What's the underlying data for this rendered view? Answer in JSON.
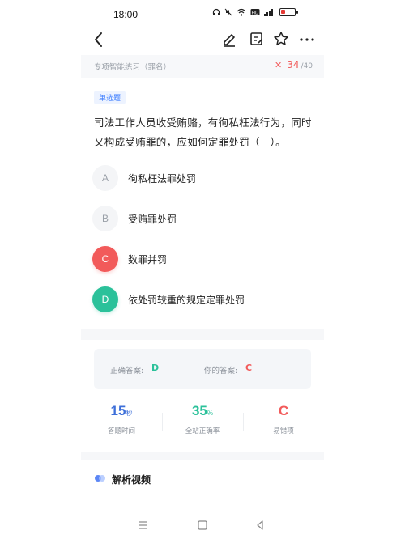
{
  "status": {
    "time": "18:00",
    "icons": [
      "headphones-icon",
      "mute-icon",
      "wifi-icon",
      "hd-icon",
      "signal-icon",
      "battery-icon"
    ]
  },
  "nav": {
    "back_icon": "chevron-left-icon",
    "actions": [
      "pencil-icon",
      "edit-note-icon",
      "star-icon",
      "more-icon"
    ]
  },
  "subhead": {
    "title": "专项智能练习（罪名）",
    "current": "34",
    "total": "/40"
  },
  "question": {
    "type_label": "单选题",
    "text": "司法工作人员收受贿赂，有徇私枉法行为，同时又构成受贿罪的，应如何定罪处罚（　）。",
    "options": [
      {
        "letter": "A",
        "text": "徇私枉法罪处罚",
        "state": "normal"
      },
      {
        "letter": "B",
        "text": "受贿罪处罚",
        "state": "normal"
      },
      {
        "letter": "C",
        "text": "数罪并罚",
        "state": "wrong"
      },
      {
        "letter": "D",
        "text": "依处罚较重的规定定罪处罚",
        "state": "correct"
      }
    ]
  },
  "answers": {
    "correct_label": "正确答案:",
    "correct_value": "D",
    "yours_label": "你的答案:",
    "yours_value": "C"
  },
  "stats": {
    "time_value": "15",
    "time_unit": "秒",
    "time_label": "答题时间",
    "rate_value": "35",
    "rate_unit": "%",
    "rate_label": "全站正确率",
    "wrong_value": "C",
    "wrong_label": "易错项"
  },
  "video": {
    "title": "解析视频"
  },
  "colors": {
    "wrong": "#f25a5a",
    "correct": "#2bc19a",
    "accent": "#3d7eff",
    "muted": "#9aa0a8"
  },
  "bottom_nav": [
    "menu-icon",
    "home-square-icon",
    "back-triangle-icon"
  ]
}
